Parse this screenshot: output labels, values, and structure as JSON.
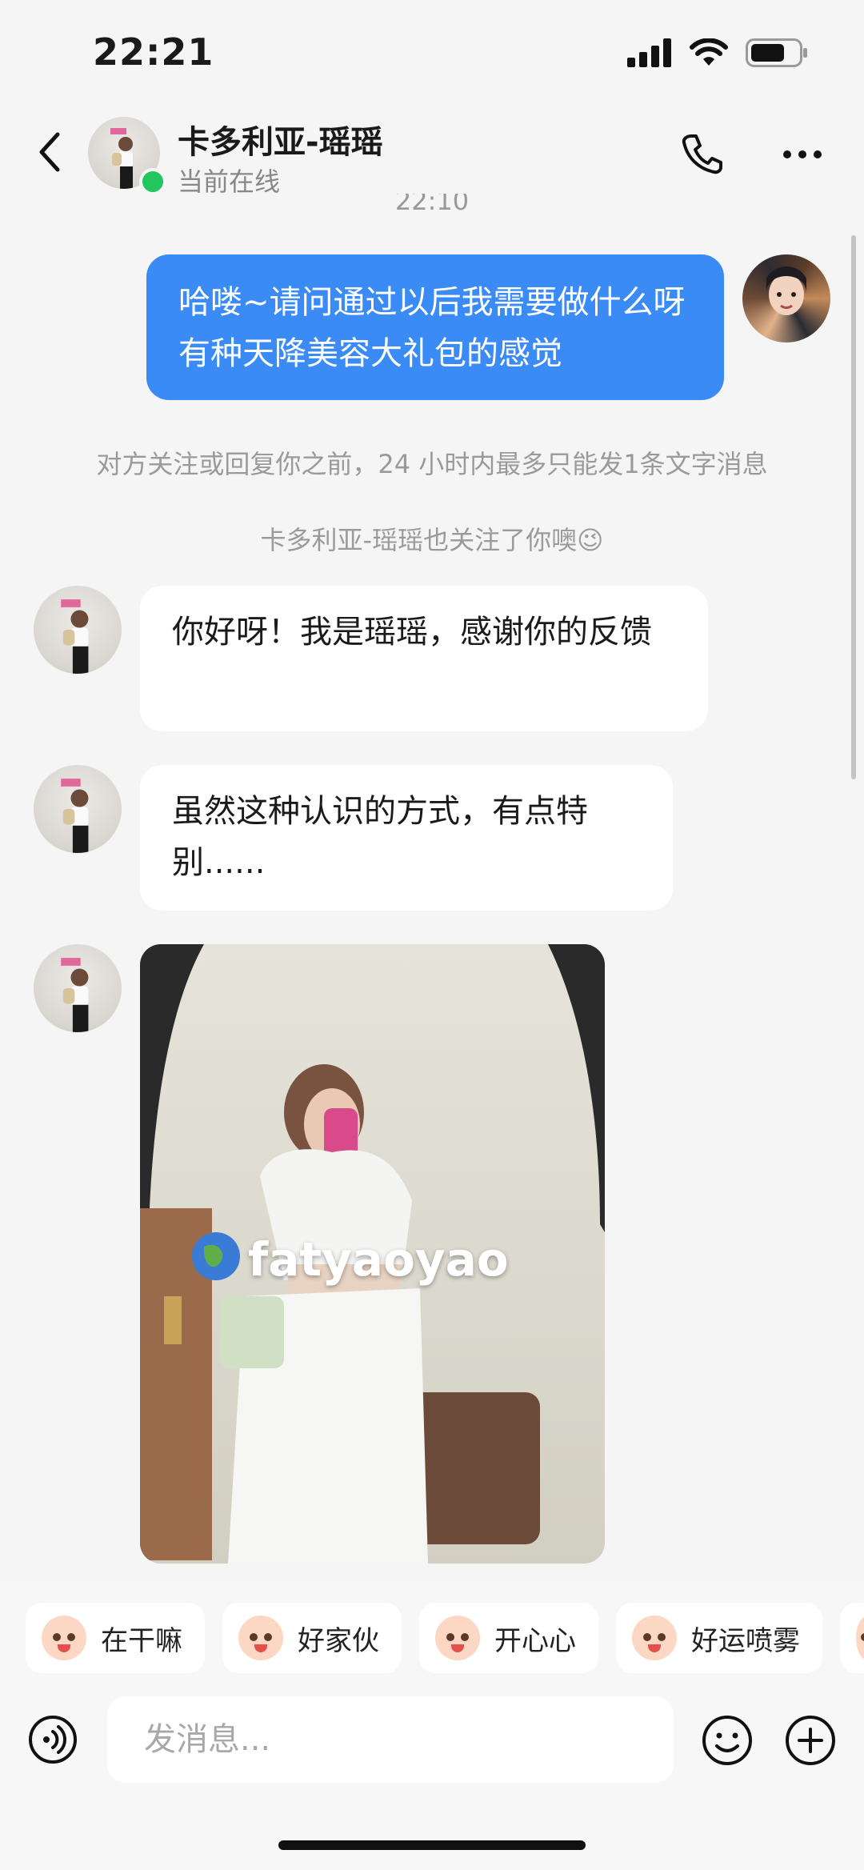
{
  "status_bar": {
    "time": "22:21",
    "battery_level": 0.7
  },
  "header": {
    "name": "卡多利亚-瑶瑶",
    "status": "当前在线"
  },
  "top_timestamp": "22:10",
  "messages": {
    "me_1": "哈喽~请问通过以后我需要做什么呀 有种天降美容大礼包的感觉",
    "system_1": "对方关注或回复你之前，24 小时内最多只能发1条文字消息",
    "system_2": "卡多利亚-瑶瑶也关注了你噢😉",
    "them_1": "你好呀！我是瑶瑶，感谢你的反馈",
    "them_2": "虽然这种认识的方式，有点特别......",
    "photo_watermark": "fatyaoyao"
  },
  "quick_replies": [
    {
      "label": "在干嘛"
    },
    {
      "label": "好家伙"
    },
    {
      "label": "开心心"
    },
    {
      "label": "好运喷雾"
    }
  ],
  "input": {
    "placeholder": "发消息..."
  },
  "colors": {
    "my_bubble": "#3b8bf7",
    "online": "#22c55e"
  }
}
